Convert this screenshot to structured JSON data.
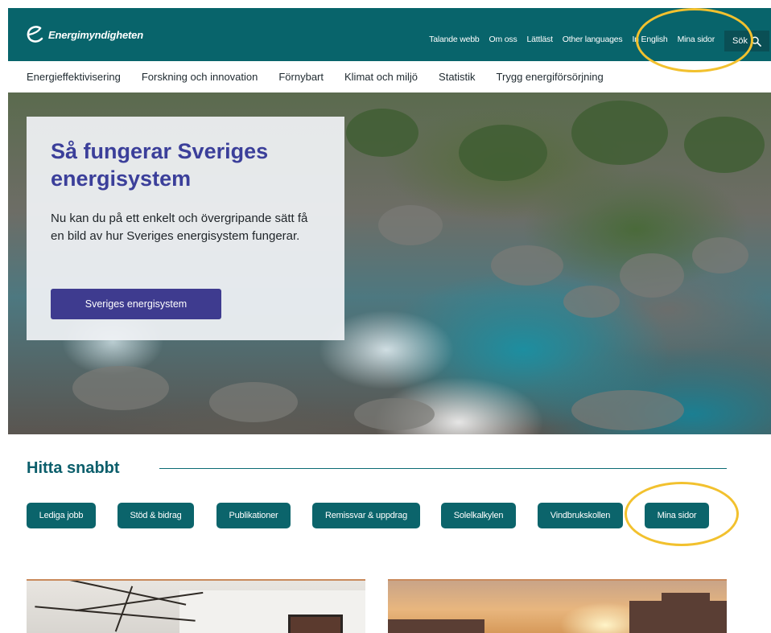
{
  "header": {
    "logo_text": "Energimyndigheten",
    "utility_links": [
      "Talande webb",
      "Om oss",
      "Lättläst",
      "Other languages",
      "In English",
      "Mina sidor"
    ],
    "search_label": "Sök"
  },
  "main_nav": [
    "Energieffektivisering",
    "Forskning och innovation",
    "Förnybart",
    "Klimat och miljö",
    "Statistik",
    "Trygg energiförsörjning"
  ],
  "hero": {
    "title": "Så fungerar Sveriges energisystem",
    "text": "Nu kan du på ett enkelt och övergripande sätt få en bild av hur Sveriges energisystem fungerar.",
    "button": "Sveriges energisystem"
  },
  "quick": {
    "title": "Hitta snabbt",
    "buttons": [
      "Lediga jobb",
      "Stöd & bidrag",
      "Publikationer",
      "Remissvar & uppdrag",
      "Solelkalkylen",
      "Vindbrukskollen",
      "Mina sidor"
    ]
  },
  "colors": {
    "brand_teal": "#08646b",
    "hero_title": "#3b3f9a",
    "hero_button": "#3e3b8f",
    "highlight": "#f2c12e"
  }
}
